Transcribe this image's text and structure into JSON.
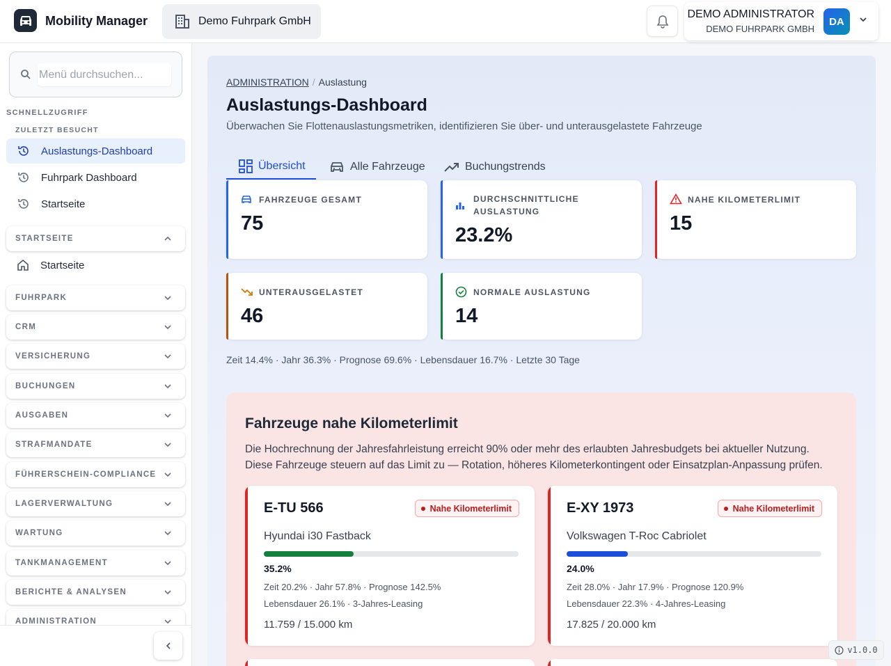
{
  "app": {
    "name": "Mobility Manager",
    "icon": "car-icon"
  },
  "org": {
    "name": "Demo Fuhrpark GmbH",
    "icon": "building-icon"
  },
  "user": {
    "name": "DEMO ADMINISTRATOR",
    "org": "DEMO FUHRPARK GMBH",
    "initials": "DA"
  },
  "sidebar": {
    "search_placeholder": "Menü durchsuchen...",
    "quick_access_label": "SCHNELLZUGRIFF",
    "recent_label": "ZULETZT BESUCHT",
    "recent": [
      {
        "label": "Auslastungs-Dashboard",
        "active": true
      },
      {
        "label": "Fuhrpark Dashboard",
        "active": false
      },
      {
        "label": "Startseite",
        "active": false
      }
    ],
    "groups": [
      {
        "label": "STARTSEITE",
        "expanded": true
      },
      {
        "label": "FUHRPARK",
        "expanded": false
      },
      {
        "label": "CRM",
        "expanded": false
      },
      {
        "label": "VERSICHERUNG",
        "expanded": false
      },
      {
        "label": "BUCHUNGEN",
        "expanded": false
      },
      {
        "label": "AUSGABEN",
        "expanded": false
      },
      {
        "label": "STRAFMANDATE",
        "expanded": false
      },
      {
        "label": "FÜHRERSCHEIN-COMPLIANCE",
        "expanded": false
      },
      {
        "label": "LAGERVERWALTUNG",
        "expanded": false
      },
      {
        "label": "WARTUNG",
        "expanded": false
      },
      {
        "label": "TANKMANAGEMENT",
        "expanded": false
      },
      {
        "label": "BERICHTE & ANALYSEN",
        "expanded": false
      },
      {
        "label": "ADMINISTRATION",
        "expanded": false
      }
    ],
    "startseite_item": "Startseite"
  },
  "breadcrumb": {
    "parent": "ADMINISTRATION",
    "current": "Auslastung"
  },
  "page": {
    "title": "Auslastungs-Dashboard",
    "subtitle": "Überwachen Sie Flottenauslastungsmetriken, identifizieren Sie über- und unterausgelastete Fahrzeuge"
  },
  "tabs": [
    {
      "label": "Übersicht",
      "icon": "grid-icon",
      "active": true
    },
    {
      "label": "Alle Fahrzeuge",
      "icon": "car-icon",
      "active": false
    },
    {
      "label": "Buchungstrends",
      "icon": "trending-up-icon",
      "active": false
    }
  ],
  "stats": {
    "total": {
      "title": "FAHRZEUGE GESAMT",
      "value": "75",
      "color": "#2563eb"
    },
    "avg": {
      "title_1": "DURCHSCHNITTLICHE",
      "title_2": "AUSLASTUNG",
      "value": "23.2%",
      "color": "#2563eb"
    },
    "near_limit": {
      "title": "NAHE KILOMETERLIMIT",
      "value": "15",
      "color": "#dc2626"
    },
    "under": {
      "title": "UNTERAUSGELASTET",
      "value": "46",
      "color": "#b45309"
    },
    "normal": {
      "title": "NORMALE AUSLASTUNG",
      "value": "14",
      "color": "#15803d"
    }
  },
  "metrics_line": "Zeit 14.4% · Jahr 36.3% · Prognose 69.6% · Lebensdauer 16.7% · Letzte 30 Tage",
  "km_section": {
    "title": "Fahrzeuge nahe Kilometerlimit",
    "desc_1": "Die Hochrechnung der Jahresfahrleistung erreicht 90% oder mehr des erlaubten Jahresbudgets bei aktueller Nutzung.",
    "desc_2": "Diese Fahrzeuge steuern auf das Limit zu — Rotation, höheres Kilometerkontingent oder Einsatzplan-Anpassung prüfen.",
    "vehicles": [
      {
        "plate": "E-TU 566",
        "badge": "Nahe Kilometerlimit",
        "model": "Hyundai i30 Fastback",
        "utilization": 0.352,
        "utilization_label": "35.2%",
        "bar_color": "#15803d",
        "line1": "Zeit 20.2% · Jahr 57.8% · Prognose 142.5%",
        "line2": "Lebensdauer 26.1% · 3-Jahres-Leasing",
        "km": "11.759 / 15.000 km"
      },
      {
        "plate": "E-XY 1973",
        "badge": "Nahe Kilometerlimit",
        "model": "Volkswagen T-Roc Cabriolet",
        "utilization": 0.24,
        "utilization_label": "24.0%",
        "bar_color": "#1d4ed8",
        "line1": "Zeit 28.0% · Jahr 17.9% · Prognose 120.9%",
        "line2": "Lebensdauer 22.3% · 4-Jahres-Leasing",
        "km": "17.825 / 20.000 km"
      }
    ]
  },
  "version": "v1.0.0"
}
